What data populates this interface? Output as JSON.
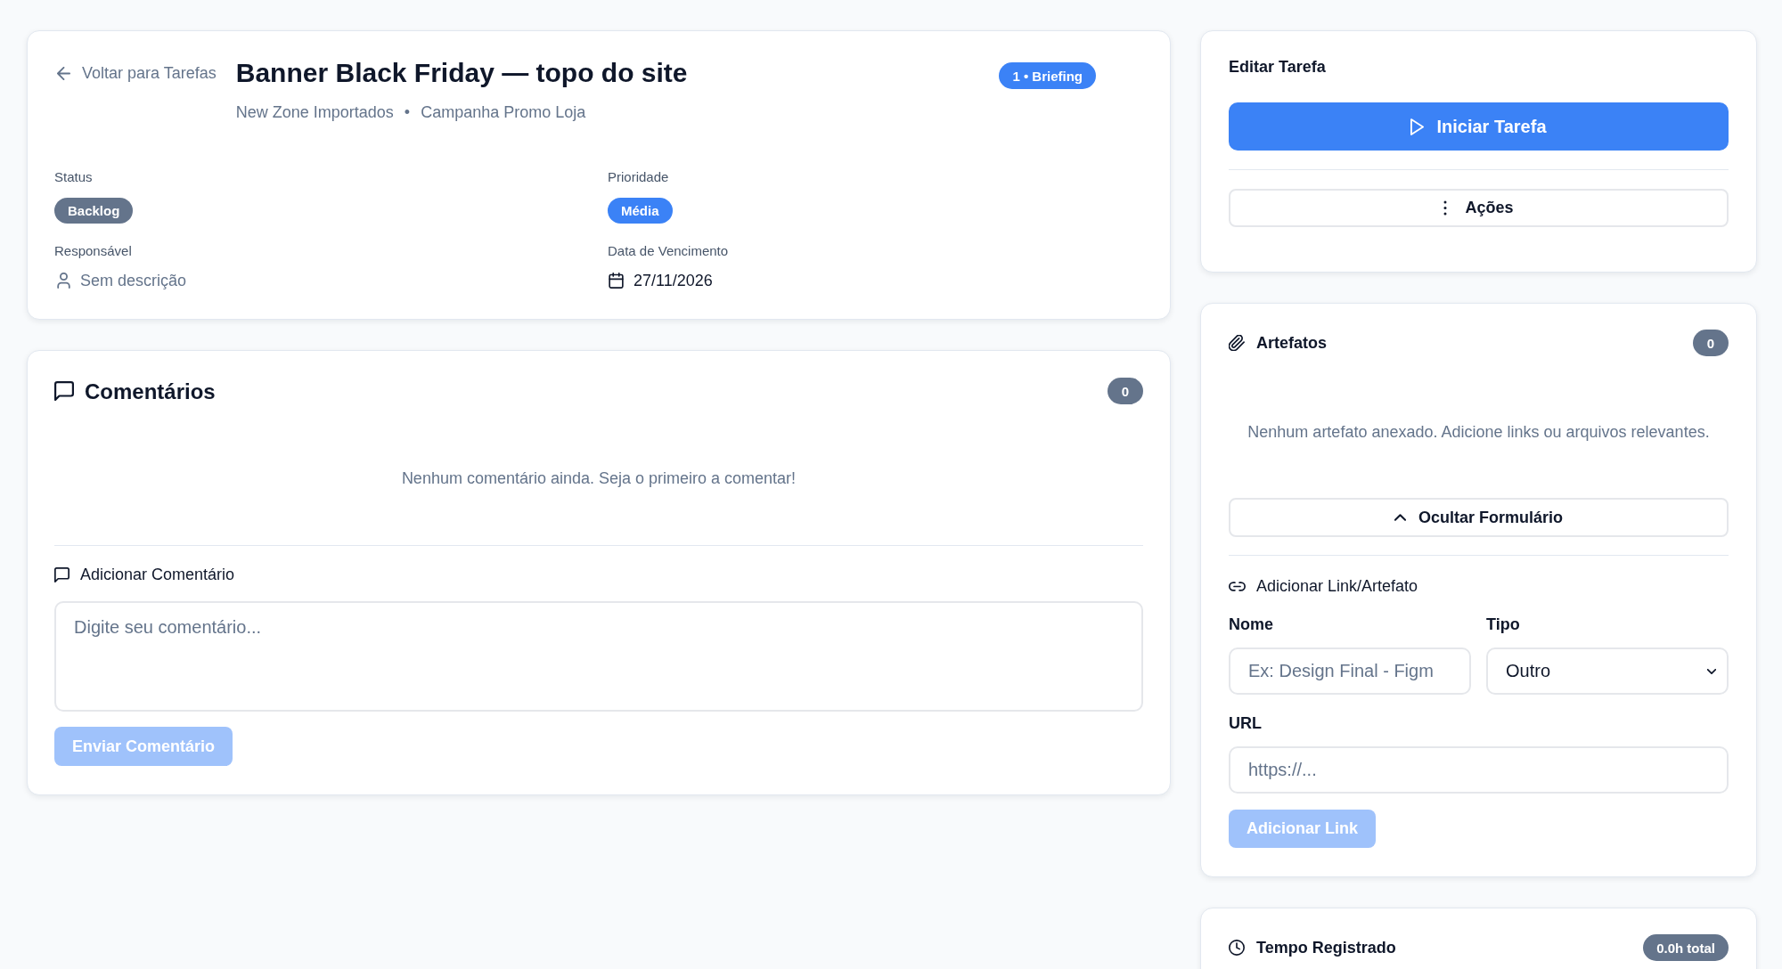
{
  "task_header": {
    "back_link": "Voltar para Tarefas",
    "title": "Banner Black Friday — topo do site",
    "client": "New Zone Importados",
    "separator": "•",
    "campaign": "Campanha Promo Loja",
    "stage_badge": "1 • Briefing"
  },
  "details": [
    {
      "label": "Status",
      "kind": "badge",
      "value": "Backlog",
      "color": "#64748b"
    },
    {
      "label": "Prioridade",
      "kind": "badge",
      "value": "Média",
      "color": "#3b82f6"
    },
    {
      "label": "Responsável",
      "kind": "person",
      "value": "Sem descrição"
    },
    {
      "label": "Data de Vencimento",
      "kind": "date",
      "value": "27/11/2026"
    }
  ],
  "comments": {
    "title": "Comentários",
    "count": "0",
    "empty_text": "Nenhum comentário ainda. Seja o primeiro a comentar!",
    "add_title": "Adicionar Comentário",
    "comment_field": {
      "placeholder": "Digite seu comentário..."
    },
    "submit_button": {
      "label": "Enviar Comentário",
      "disabled": true
    }
  },
  "edit_task": {
    "title": "Editar Tarefa",
    "start_button": "Iniciar Tarefa",
    "actions_button": "Ações"
  },
  "artifacts": {
    "title": "Artefatos",
    "count": "0",
    "empty_text": "Nenhum artefato anexado. Adicione links ou arquivos relevantes.",
    "toggle_button": {
      "label": "Ocultar Formulário",
      "expanded": true
    },
    "form": {
      "title": "Adicionar Link/Artefato",
      "name_field": {
        "label": "Nome",
        "placeholder": "Ex: Design Final - Figm"
      },
      "type_field": {
        "label": "Tipo",
        "value": "Outro"
      },
      "url_field": {
        "label": "URL",
        "placeholder": "https://..."
      },
      "submit_button": {
        "label": "Adicionar Link",
        "disabled": true
      }
    }
  },
  "time_log": {
    "title": "Tempo Registrado",
    "total": "0.0h total"
  }
}
